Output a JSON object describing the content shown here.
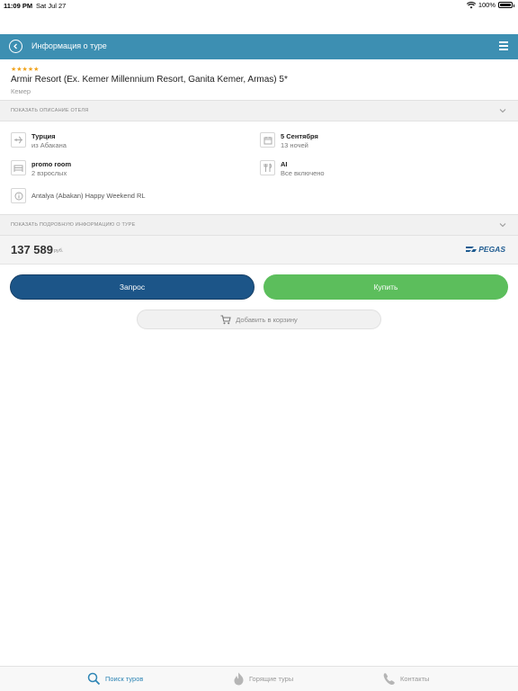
{
  "statusbar": {
    "time": "11:09 PM",
    "date": "Sat Jul 27",
    "battery": "100%"
  },
  "navbar": {
    "title": "Информация о туре"
  },
  "hotel": {
    "stars": "★★★★★",
    "name": "Armir Resort (Ex. Kemer Millennium Resort, Ganita Kemer, Armas) 5*",
    "city": "Кемер"
  },
  "sections": {
    "hotel_description": "Показать описание отеля",
    "tour_details": "Показать подробную информацию о туре"
  },
  "details": {
    "country": "Турция",
    "departure": "из Абакана",
    "date": "5 Сентября",
    "nights": "13 ночей",
    "room": "promo room",
    "guests": "2 взрослых",
    "meal": "AI",
    "meal_desc": "Все включено",
    "tour_name": "Antalya (Abakan) Happy Weekend RL"
  },
  "price": {
    "value": "137 589",
    "currency": "руб.",
    "operator": "PEGAS"
  },
  "buttons": {
    "request": "Запрос",
    "buy": "Купить",
    "add_to_cart": "Добавить в корзину"
  },
  "tabbar": {
    "search": "Поиск туров",
    "hot": "Горящие туры",
    "contacts": "Контакты"
  },
  "colors": {
    "navbar": "#3d8fb2",
    "request": "#1c5588",
    "buy": "#5cbe5c",
    "stars": "#f0a31b",
    "active_tab": "#2f86b5"
  }
}
